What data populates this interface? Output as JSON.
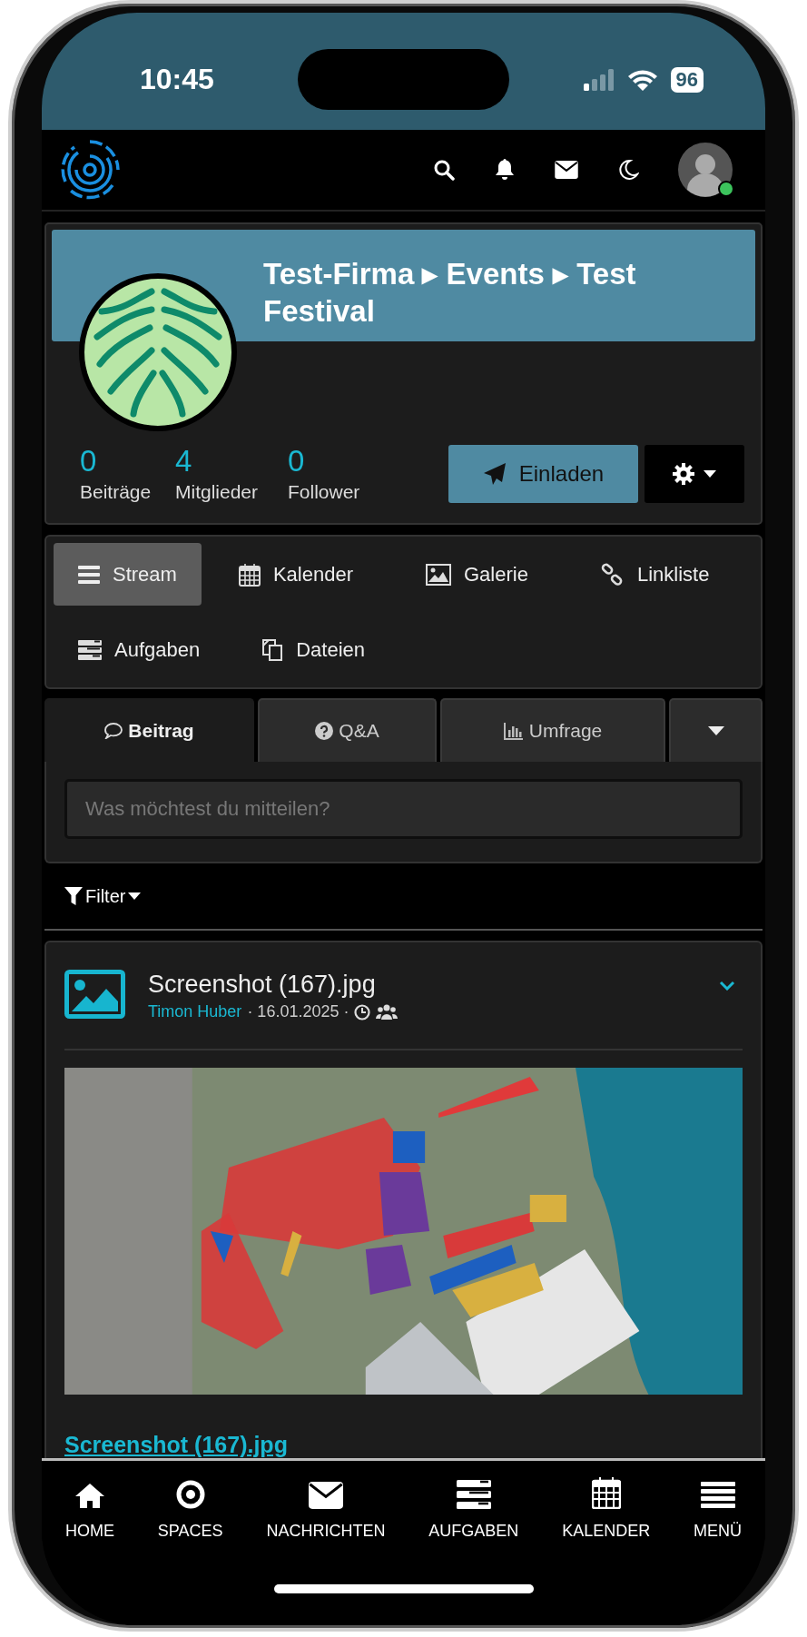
{
  "status_bar": {
    "time": "10:45",
    "battery": "96"
  },
  "top_nav": {
    "user": {
      "online": true
    }
  },
  "space_header": {
    "title": "Test-Firma ▸ Events ▸ Test Festival",
    "stats": [
      {
        "value": "0",
        "label": "Beiträge"
      },
      {
        "value": "4",
        "label": "Mitglieder"
      },
      {
        "value": "0",
        "label": "Follower"
      }
    ],
    "invite_button": "Einladen"
  },
  "space_nav": [
    {
      "label": "Stream",
      "selected": true
    },
    {
      "label": "Kalender",
      "selected": false
    },
    {
      "label": "Galerie",
      "selected": false
    },
    {
      "label": "Linkliste",
      "selected": false
    },
    {
      "label": "Aufgaben",
      "selected": false
    },
    {
      "label": "Dateien",
      "selected": false
    }
  ],
  "composer": {
    "tabs": [
      {
        "label": "Beitrag",
        "selected": true
      },
      {
        "label": "Q&A",
        "selected": false
      },
      {
        "label": "Umfrage",
        "selected": false
      }
    ],
    "placeholder": "Was möchtest du mitteilen?"
  },
  "filter": "Filter",
  "post": {
    "title": "Screenshot (167).jpg",
    "author": "Timon Huber",
    "date": "· 16.01.2025 ·",
    "link": "Screenshot (167).jpg"
  },
  "bottom_nav": [
    "HOME",
    "SPACES",
    "NACHRICHTEN",
    "AUFGABEN",
    "KALENDER",
    "MENÜ"
  ]
}
